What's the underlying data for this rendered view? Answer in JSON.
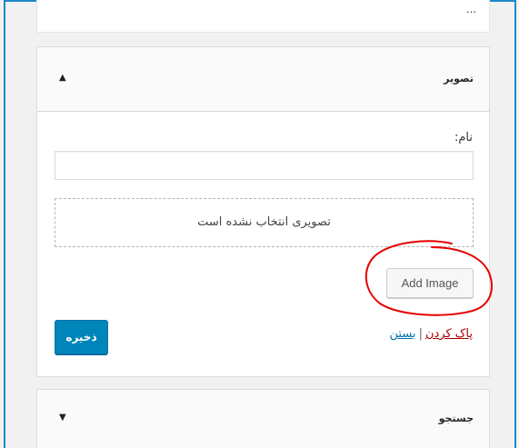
{
  "top_widget": {
    "header_glyph": "…"
  },
  "image_widget": {
    "title": "تصویر",
    "toggle_arrow": "▲",
    "name_label": "نام:",
    "name_value": "",
    "no_image_text": "تصویری انتخاب نشده است",
    "add_image_label": "Add Image",
    "save_label": "ذخیره",
    "delete_link": "پاک کردن",
    "separator": "|",
    "close_link": "بستن"
  },
  "search_widget": {
    "title": "جستجو",
    "toggle_arrow": "▼"
  },
  "colors": {
    "frame": "#1d8ac9",
    "save_button": "#0085ba",
    "delete_link": "#aa0000",
    "close_link": "#0073aa",
    "annotation": "#e60000"
  }
}
